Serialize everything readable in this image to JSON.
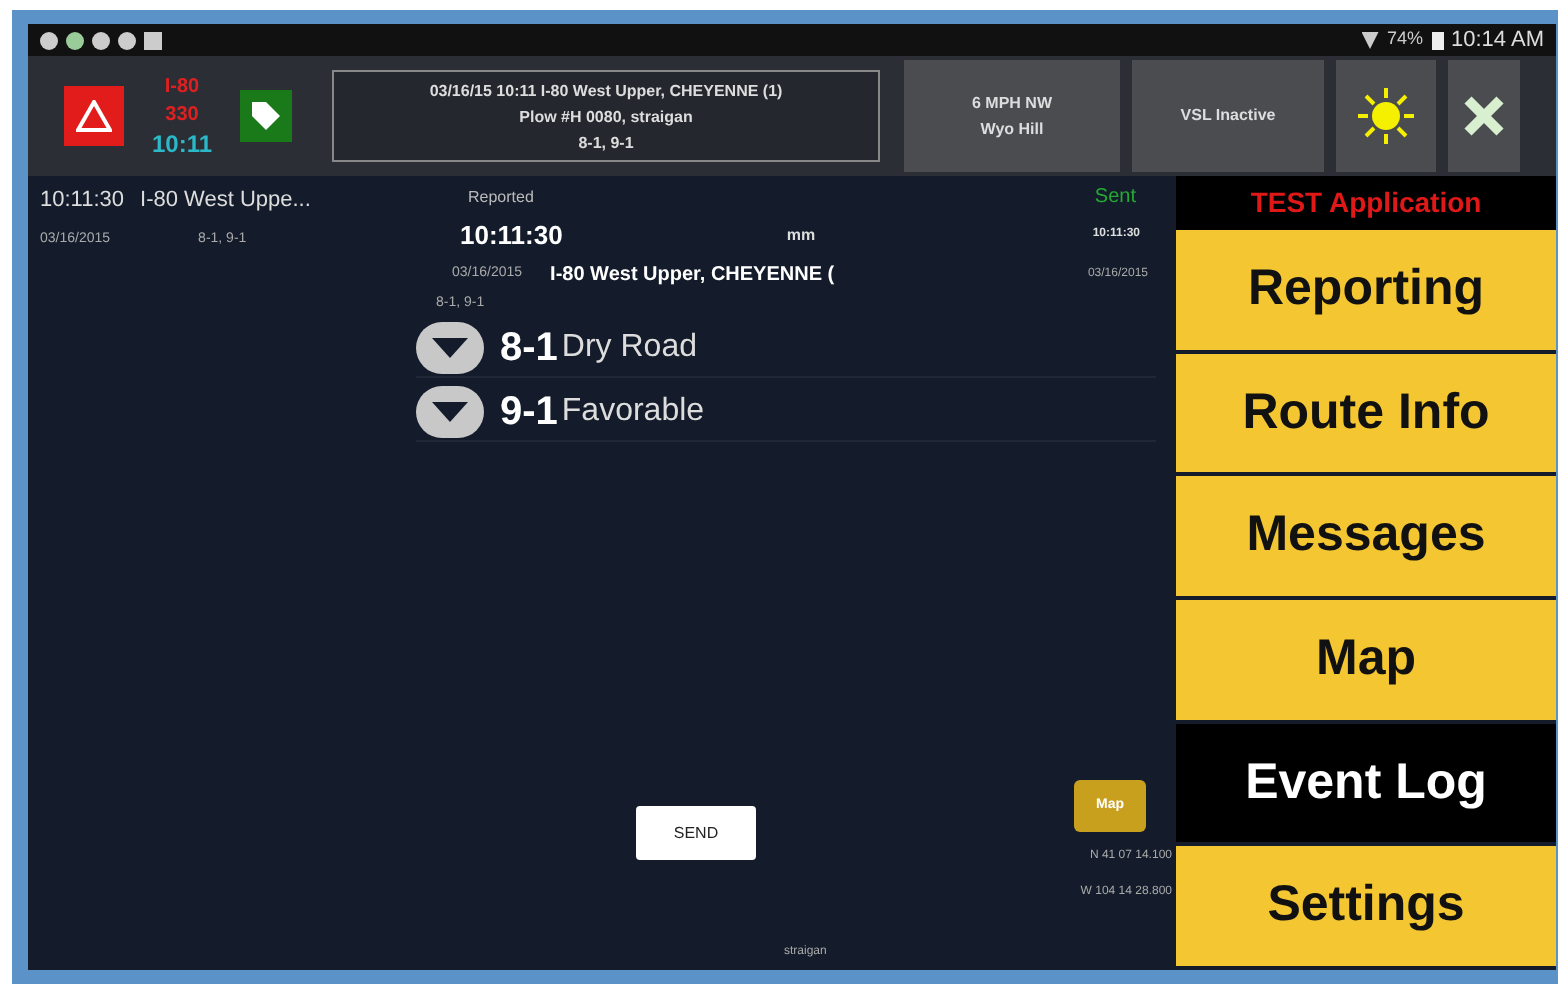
{
  "status_bar": {
    "battery": "74%",
    "time": "10:14 AM"
  },
  "toolbar": {
    "alert_lines": [
      "I-80",
      "330",
      "10:11"
    ],
    "note_lines": [
      "03/16/15 10:11 I-80 West Upper, CHEYENNE (1)",
      "Plow #H 0080, straigan",
      "8-1, 9-1"
    ],
    "speed_lines": [
      "6 MPH NW",
      "Wyo Hill"
    ],
    "vsl": "VSL Inactive"
  },
  "log": [
    {
      "time": "10:11:30",
      "location": "I-80 West Uppe...",
      "date": "03/16/2015",
      "codes": "8-1, 9-1"
    }
  ],
  "detail": {
    "status": "Reported",
    "sent": "Sent",
    "time": "10:11:30",
    "unit": "mm",
    "sent_time": "10:11:30",
    "date": "03/16/2015",
    "location": "I-80 West Upper, CHEYENNE (",
    "sent_date": "03/16/2015",
    "codes": "8-1, 9-1",
    "conditions": [
      {
        "code": "8-1",
        "label": "Dry Road"
      },
      {
        "code": "9-1",
        "label": "Favorable"
      }
    ],
    "send": "SEND",
    "author": "straigan",
    "map": "Map",
    "coords": [
      "N 41 07 14.100",
      "W 104 14 28.800"
    ]
  },
  "menu": {
    "header": "TEST Application",
    "items": [
      {
        "label": "Reporting",
        "selected": false
      },
      {
        "label": "Route Info",
        "selected": false
      },
      {
        "label": "Messages",
        "selected": false
      },
      {
        "label": "Map",
        "selected": false
      },
      {
        "label": "Event Log",
        "selected": true
      },
      {
        "label": "Settings",
        "selected": false
      }
    ]
  }
}
